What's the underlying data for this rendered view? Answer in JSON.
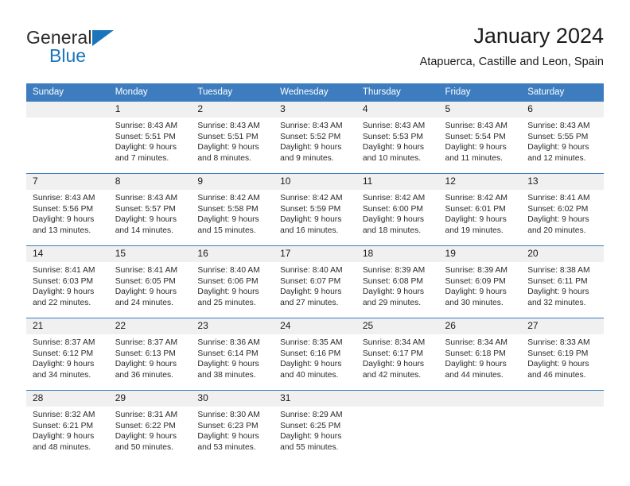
{
  "brand": {
    "name_top": "General",
    "name_bottom": "Blue",
    "accent_color": "#1b75bb"
  },
  "header": {
    "title": "January 2024",
    "subtitle": "Atapuerca, Castille and Leon, Spain"
  },
  "calendar": {
    "header_bg": "#3d7dbf",
    "daynum_bg": "#f0f0f0",
    "weekday_headers": [
      "Sunday",
      "Monday",
      "Tuesday",
      "Wednesday",
      "Thursday",
      "Friday",
      "Saturday"
    ],
    "weeks": [
      [
        {
          "day": "",
          "sunrise": "",
          "sunset": "",
          "daylight_line1": "",
          "daylight_line2": ""
        },
        {
          "day": "1",
          "sunrise": "Sunrise: 8:43 AM",
          "sunset": "Sunset: 5:51 PM",
          "daylight_line1": "Daylight: 9 hours",
          "daylight_line2": "and 7 minutes."
        },
        {
          "day": "2",
          "sunrise": "Sunrise: 8:43 AM",
          "sunset": "Sunset: 5:51 PM",
          "daylight_line1": "Daylight: 9 hours",
          "daylight_line2": "and 8 minutes."
        },
        {
          "day": "3",
          "sunrise": "Sunrise: 8:43 AM",
          "sunset": "Sunset: 5:52 PM",
          "daylight_line1": "Daylight: 9 hours",
          "daylight_line2": "and 9 minutes."
        },
        {
          "day": "4",
          "sunrise": "Sunrise: 8:43 AM",
          "sunset": "Sunset: 5:53 PM",
          "daylight_line1": "Daylight: 9 hours",
          "daylight_line2": "and 10 minutes."
        },
        {
          "day": "5",
          "sunrise": "Sunrise: 8:43 AM",
          "sunset": "Sunset: 5:54 PM",
          "daylight_line1": "Daylight: 9 hours",
          "daylight_line2": "and 11 minutes."
        },
        {
          "day": "6",
          "sunrise": "Sunrise: 8:43 AM",
          "sunset": "Sunset: 5:55 PM",
          "daylight_line1": "Daylight: 9 hours",
          "daylight_line2": "and 12 minutes."
        }
      ],
      [
        {
          "day": "7",
          "sunrise": "Sunrise: 8:43 AM",
          "sunset": "Sunset: 5:56 PM",
          "daylight_line1": "Daylight: 9 hours",
          "daylight_line2": "and 13 minutes."
        },
        {
          "day": "8",
          "sunrise": "Sunrise: 8:43 AM",
          "sunset": "Sunset: 5:57 PM",
          "daylight_line1": "Daylight: 9 hours",
          "daylight_line2": "and 14 minutes."
        },
        {
          "day": "9",
          "sunrise": "Sunrise: 8:42 AM",
          "sunset": "Sunset: 5:58 PM",
          "daylight_line1": "Daylight: 9 hours",
          "daylight_line2": "and 15 minutes."
        },
        {
          "day": "10",
          "sunrise": "Sunrise: 8:42 AM",
          "sunset": "Sunset: 5:59 PM",
          "daylight_line1": "Daylight: 9 hours",
          "daylight_line2": "and 16 minutes."
        },
        {
          "day": "11",
          "sunrise": "Sunrise: 8:42 AM",
          "sunset": "Sunset: 6:00 PM",
          "daylight_line1": "Daylight: 9 hours",
          "daylight_line2": "and 18 minutes."
        },
        {
          "day": "12",
          "sunrise": "Sunrise: 8:42 AM",
          "sunset": "Sunset: 6:01 PM",
          "daylight_line1": "Daylight: 9 hours",
          "daylight_line2": "and 19 minutes."
        },
        {
          "day": "13",
          "sunrise": "Sunrise: 8:41 AM",
          "sunset": "Sunset: 6:02 PM",
          "daylight_line1": "Daylight: 9 hours",
          "daylight_line2": "and 20 minutes."
        }
      ],
      [
        {
          "day": "14",
          "sunrise": "Sunrise: 8:41 AM",
          "sunset": "Sunset: 6:03 PM",
          "daylight_line1": "Daylight: 9 hours",
          "daylight_line2": "and 22 minutes."
        },
        {
          "day": "15",
          "sunrise": "Sunrise: 8:41 AM",
          "sunset": "Sunset: 6:05 PM",
          "daylight_line1": "Daylight: 9 hours",
          "daylight_line2": "and 24 minutes."
        },
        {
          "day": "16",
          "sunrise": "Sunrise: 8:40 AM",
          "sunset": "Sunset: 6:06 PM",
          "daylight_line1": "Daylight: 9 hours",
          "daylight_line2": "and 25 minutes."
        },
        {
          "day": "17",
          "sunrise": "Sunrise: 8:40 AM",
          "sunset": "Sunset: 6:07 PM",
          "daylight_line1": "Daylight: 9 hours",
          "daylight_line2": "and 27 minutes."
        },
        {
          "day": "18",
          "sunrise": "Sunrise: 8:39 AM",
          "sunset": "Sunset: 6:08 PM",
          "daylight_line1": "Daylight: 9 hours",
          "daylight_line2": "and 29 minutes."
        },
        {
          "day": "19",
          "sunrise": "Sunrise: 8:39 AM",
          "sunset": "Sunset: 6:09 PM",
          "daylight_line1": "Daylight: 9 hours",
          "daylight_line2": "and 30 minutes."
        },
        {
          "day": "20",
          "sunrise": "Sunrise: 8:38 AM",
          "sunset": "Sunset: 6:11 PM",
          "daylight_line1": "Daylight: 9 hours",
          "daylight_line2": "and 32 minutes."
        }
      ],
      [
        {
          "day": "21",
          "sunrise": "Sunrise: 8:37 AM",
          "sunset": "Sunset: 6:12 PM",
          "daylight_line1": "Daylight: 9 hours",
          "daylight_line2": "and 34 minutes."
        },
        {
          "day": "22",
          "sunrise": "Sunrise: 8:37 AM",
          "sunset": "Sunset: 6:13 PM",
          "daylight_line1": "Daylight: 9 hours",
          "daylight_line2": "and 36 minutes."
        },
        {
          "day": "23",
          "sunrise": "Sunrise: 8:36 AM",
          "sunset": "Sunset: 6:14 PM",
          "daylight_line1": "Daylight: 9 hours",
          "daylight_line2": "and 38 minutes."
        },
        {
          "day": "24",
          "sunrise": "Sunrise: 8:35 AM",
          "sunset": "Sunset: 6:16 PM",
          "daylight_line1": "Daylight: 9 hours",
          "daylight_line2": "and 40 minutes."
        },
        {
          "day": "25",
          "sunrise": "Sunrise: 8:34 AM",
          "sunset": "Sunset: 6:17 PM",
          "daylight_line1": "Daylight: 9 hours",
          "daylight_line2": "and 42 minutes."
        },
        {
          "day": "26",
          "sunrise": "Sunrise: 8:34 AM",
          "sunset": "Sunset: 6:18 PM",
          "daylight_line1": "Daylight: 9 hours",
          "daylight_line2": "and 44 minutes."
        },
        {
          "day": "27",
          "sunrise": "Sunrise: 8:33 AM",
          "sunset": "Sunset: 6:19 PM",
          "daylight_line1": "Daylight: 9 hours",
          "daylight_line2": "and 46 minutes."
        }
      ],
      [
        {
          "day": "28",
          "sunrise": "Sunrise: 8:32 AM",
          "sunset": "Sunset: 6:21 PM",
          "daylight_line1": "Daylight: 9 hours",
          "daylight_line2": "and 48 minutes."
        },
        {
          "day": "29",
          "sunrise": "Sunrise: 8:31 AM",
          "sunset": "Sunset: 6:22 PM",
          "daylight_line1": "Daylight: 9 hours",
          "daylight_line2": "and 50 minutes."
        },
        {
          "day": "30",
          "sunrise": "Sunrise: 8:30 AM",
          "sunset": "Sunset: 6:23 PM",
          "daylight_line1": "Daylight: 9 hours",
          "daylight_line2": "and 53 minutes."
        },
        {
          "day": "31",
          "sunrise": "Sunrise: 8:29 AM",
          "sunset": "Sunset: 6:25 PM",
          "daylight_line1": "Daylight: 9 hours",
          "daylight_line2": "and 55 minutes."
        },
        {
          "day": "",
          "sunrise": "",
          "sunset": "",
          "daylight_line1": "",
          "daylight_line2": ""
        },
        {
          "day": "",
          "sunrise": "",
          "sunset": "",
          "daylight_line1": "",
          "daylight_line2": ""
        },
        {
          "day": "",
          "sunrise": "",
          "sunset": "",
          "daylight_line1": "",
          "daylight_line2": ""
        }
      ]
    ]
  }
}
